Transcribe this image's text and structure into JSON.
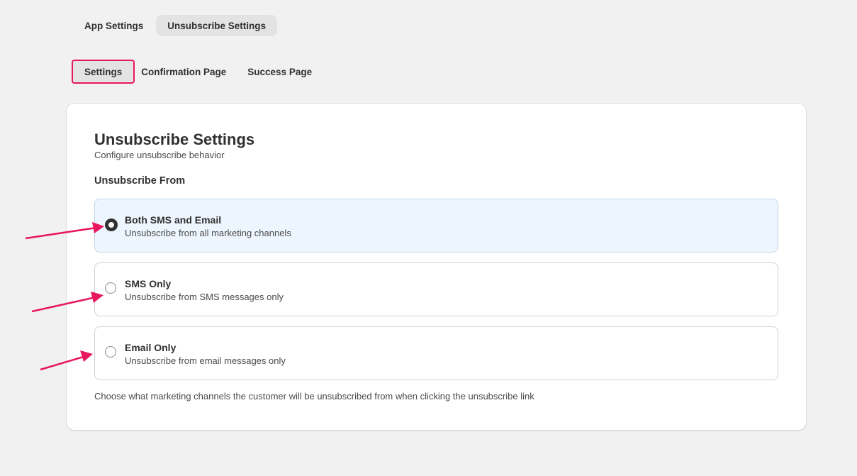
{
  "top_tabs": [
    {
      "label": "App Settings",
      "active": false
    },
    {
      "label": "Unsubscribe Settings",
      "active": true
    }
  ],
  "sub_tabs": [
    {
      "label": "Settings",
      "active": true
    },
    {
      "label": "Confirmation Page",
      "active": false
    },
    {
      "label": "Success Page",
      "active": false
    }
  ],
  "card": {
    "title": "Unsubscribe Settings",
    "subtitle": "Configure unsubscribe behavior",
    "section_label": "Unsubscribe From",
    "options": [
      {
        "label": "Both SMS and Email",
        "description": "Unsubscribe from all marketing channels",
        "selected": true
      },
      {
        "label": "SMS Only",
        "description": "Unsubscribe from SMS messages only",
        "selected": false
      },
      {
        "label": "Email Only",
        "description": "Unsubscribe from email messages only",
        "selected": false
      }
    ],
    "help_text": "Choose what marketing channels the customer will be unsubscribed from when clicking the unsubscribe link"
  },
  "colors": {
    "highlight": "#e8175d",
    "selected_bg": "#edf5fe",
    "page_bg": "#f1f1f1"
  }
}
